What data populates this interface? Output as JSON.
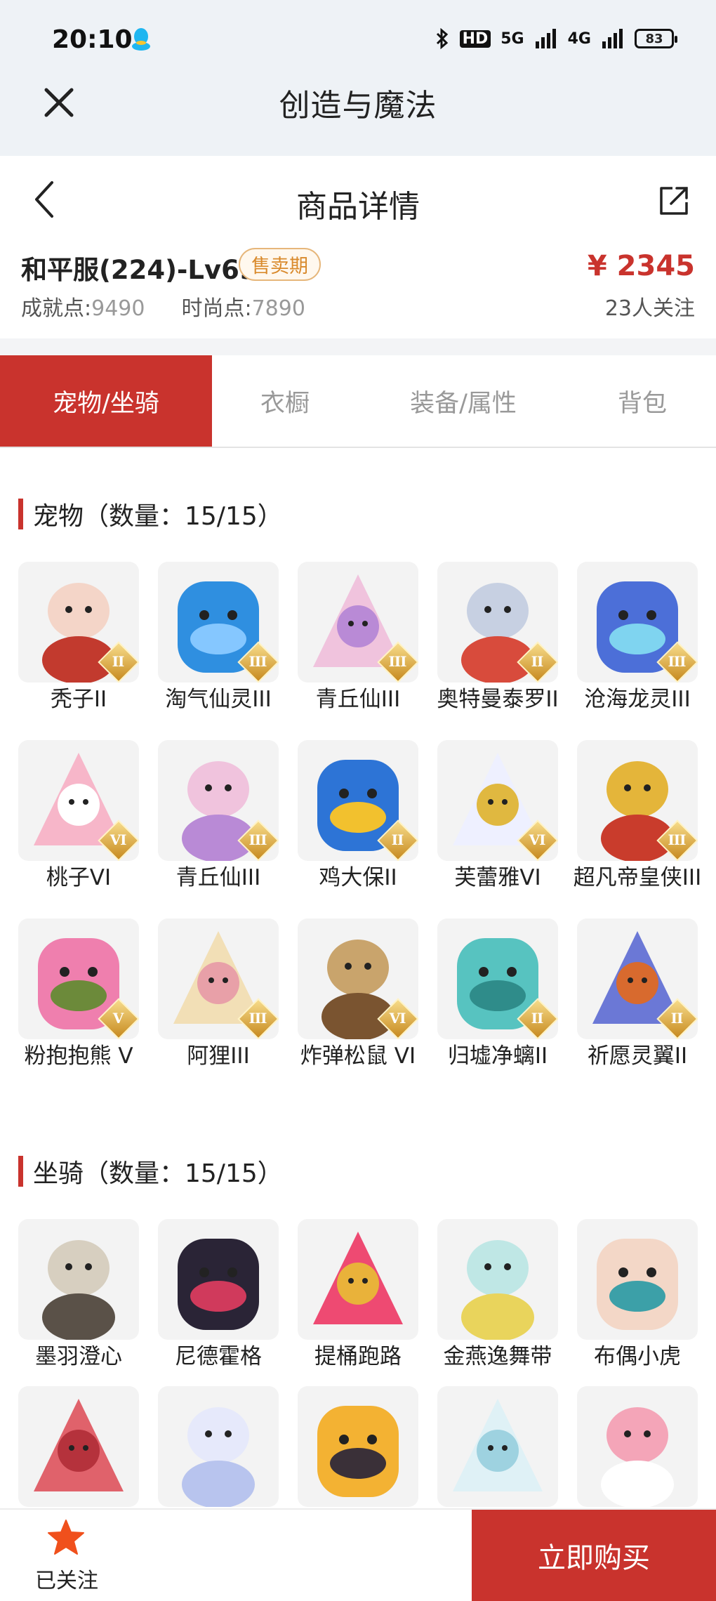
{
  "status_bar": {
    "time": "20:10",
    "signal_label": "5G",
    "network_label": "4G",
    "battery_level": "83",
    "hd_label": "HD"
  },
  "app": {
    "title": "创造与魔法"
  },
  "page": {
    "title": "商品详情"
  },
  "product": {
    "server": "和平服(224)-Lv69",
    "sale_badge": "售卖期",
    "price": "¥ 2345",
    "achievement_label": "成就点:",
    "achievement_value": "9490",
    "fashion_label": "时尚点:",
    "fashion_value": "7890",
    "followers": "23人关注"
  },
  "tabs": [
    {
      "label": "宠物/坐骑",
      "active": true
    },
    {
      "label": "衣橱",
      "active": false
    },
    {
      "label": "装备/属性",
      "active": false
    },
    {
      "label": "背包",
      "active": false
    }
  ],
  "pets_section": {
    "title": "宠物（数量：15/15）",
    "items": [
      {
        "name": "秃子II",
        "rank": "II"
      },
      {
        "name": "淘气仙灵III",
        "rank": "III"
      },
      {
        "name": "青丘仙III",
        "rank": "III"
      },
      {
        "name": "奥特曼泰罗II",
        "rank": "II"
      },
      {
        "name": "沧海龙灵III",
        "rank": "III"
      },
      {
        "name": "桃子VI",
        "rank": "VI"
      },
      {
        "name": "青丘仙III",
        "rank": "III"
      },
      {
        "name": "鸡大保II",
        "rank": "II"
      },
      {
        "name": "芙蕾雅VI",
        "rank": "VI"
      },
      {
        "name": "超凡帝皇侠III",
        "rank": "III"
      },
      {
        "name": "粉抱抱熊 V",
        "rank": "V"
      },
      {
        "name": "阿狸III",
        "rank": "III"
      },
      {
        "name": "炸弹松鼠 VI",
        "rank": "VI"
      },
      {
        "name": "归墟净螭II",
        "rank": "II"
      },
      {
        "name": "祈愿灵翼II",
        "rank": "II"
      }
    ]
  },
  "mounts_section": {
    "title": "坐骑（数量：15/15）",
    "items": [
      {
        "name": "墨羽澄心"
      },
      {
        "name": "尼德霍格"
      },
      {
        "name": "提桶跑路"
      },
      {
        "name": "金燕逸舞带"
      },
      {
        "name": "布偶小虎"
      },
      {
        "name": ""
      },
      {
        "name": ""
      },
      {
        "name": ""
      },
      {
        "name": ""
      },
      {
        "name": ""
      }
    ]
  },
  "bottom_bar": {
    "follow_label": "已关注",
    "buy_label": "立即购买"
  },
  "colors": {
    "accent": "#c9332d",
    "badge_border": "#e6b67a",
    "badge_text": "#d98a2c",
    "star": "#f0501c"
  }
}
